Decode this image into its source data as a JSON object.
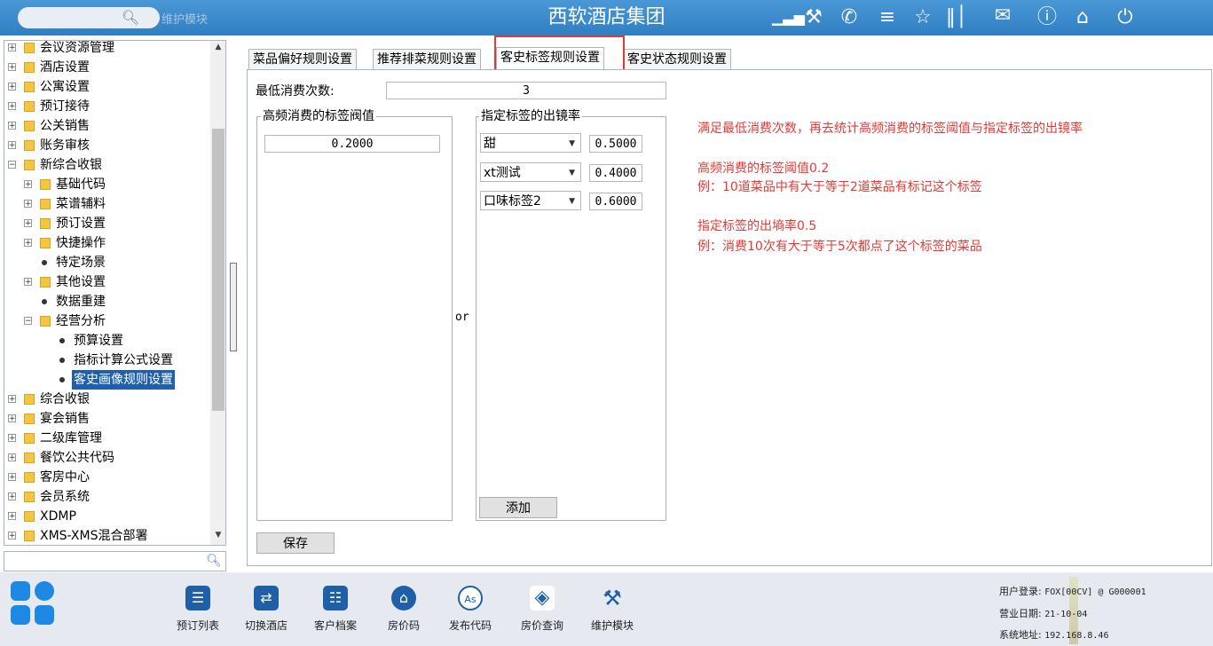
{
  "header": {
    "search_icon": "search-icon",
    "module_label": "维护模块",
    "title": "西软酒店集团",
    "icons": [
      "signal-icon",
      "tools-icon",
      "phone-icon",
      "menu-icon",
      "star-icon",
      "columns-icon",
      "mail-icon",
      "help-icon",
      "home-icon",
      "power-icon"
    ]
  },
  "tree": {
    "items": [
      {
        "label": "会议资源管理"
      },
      {
        "label": "酒店设置"
      },
      {
        "label": "公寓设置"
      },
      {
        "label": "预订接待"
      },
      {
        "label": "公关销售"
      },
      {
        "label": "账务审核"
      },
      {
        "label": "新综合收银"
      },
      {
        "label": "基础代码"
      },
      {
        "label": "菜谱辅料"
      },
      {
        "label": "预订设置"
      },
      {
        "label": "快捷操作"
      },
      {
        "label": "特定场景"
      },
      {
        "label": "其他设置"
      },
      {
        "label": "数据重建"
      },
      {
        "label": "经营分析"
      },
      {
        "label": "预算设置"
      },
      {
        "label": "指标计算公式设置"
      },
      {
        "label": "客史画像规则设置"
      },
      {
        "label": "综合收银"
      },
      {
        "label": "宴会销售"
      },
      {
        "label": "二级库管理"
      },
      {
        "label": "餐饮公共代码"
      },
      {
        "label": "客房中心"
      },
      {
        "label": "会员系统"
      },
      {
        "label": "XDMP"
      },
      {
        "label": "XMS-XMS混合部署"
      }
    ],
    "selected": "客史画像规则设置"
  },
  "tabs": [
    "菜品偏好规则设置",
    "推荐排菜规则设置",
    "客史标签规则设置",
    "客史状态规则设置"
  ],
  "form": {
    "min_count_label": "最低消费次数:",
    "min_count_value": "3",
    "threshold_group": "高频消费的标签阀值",
    "threshold_value": "0.2000",
    "or_label": "or",
    "rate_group": "指定标签的出镜率",
    "rows": [
      {
        "tag": "甜",
        "rate": "0.5000"
      },
      {
        "tag": "xt测试",
        "rate": "0.4000"
      },
      {
        "tag": "口味标签2",
        "rate": "0.6000"
      }
    ],
    "add_label": "添加",
    "save_label": "保存"
  },
  "notes": {
    "line1": "满足最低消费次数，再去统计高频消费的标签阈值与指定标签的出镜率",
    "line2": "高频消费的标签阈值0.2",
    "line3": "例：10道菜品中有大于等于2道菜品有标记这个标签",
    "line4": "指定标签的出墒率0.5",
    "line5": "例：消费10次有大于等于5次都点了这个标签的菜品"
  },
  "dock": [
    {
      "label": "预订列表",
      "icon": "booking-list-icon"
    },
    {
      "label": "切换酒店",
      "icon": "switch-hotel-icon"
    },
    {
      "label": "客户档案",
      "icon": "customer-file-icon"
    },
    {
      "label": "房价码",
      "icon": "rate-code-icon"
    },
    {
      "label": "发布代码",
      "icon": "publish-code-icon"
    },
    {
      "label": "房价查询",
      "icon": "rate-query-icon"
    },
    {
      "label": "维护模块",
      "icon": "maintenance-icon"
    }
  ],
  "system": {
    "login_label": "用户登录:",
    "login_value": "FOX[00CV] @ G000001",
    "date_label": "营业日期:",
    "date_value": "21-10-04",
    "addr_label": "系统地址:",
    "addr_value": "192.168.8.46"
  }
}
